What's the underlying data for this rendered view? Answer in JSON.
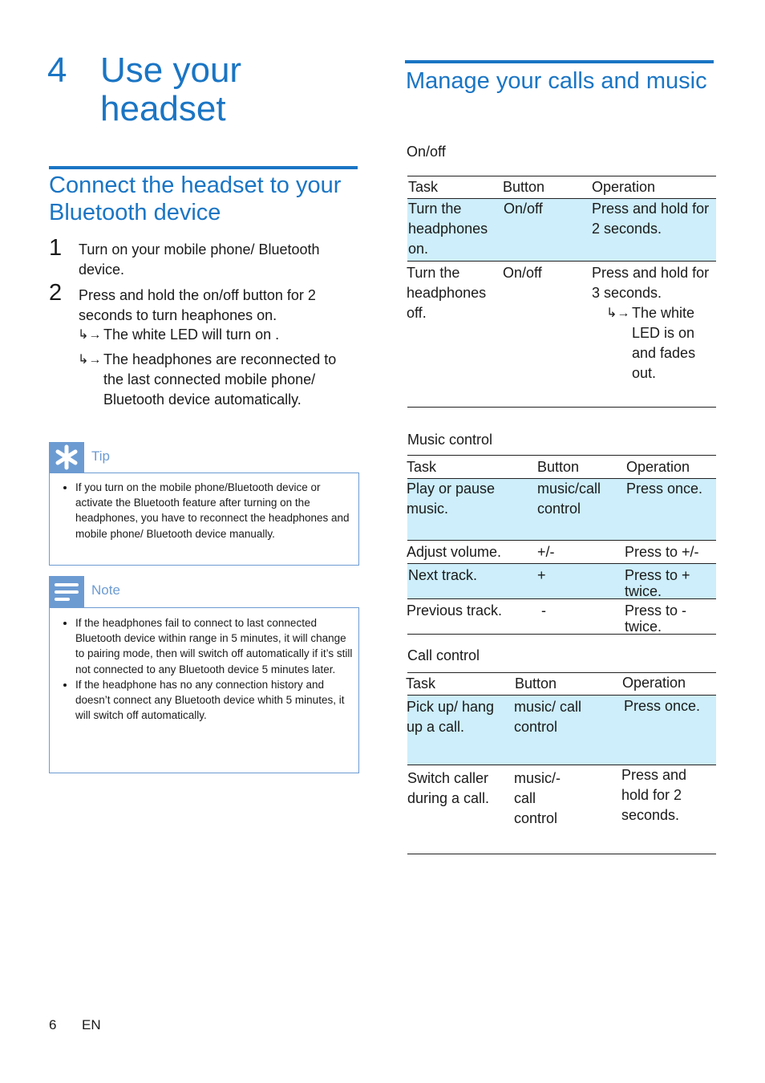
{
  "chapter": {
    "number": "4",
    "title": "Use your headset"
  },
  "connect_section": {
    "title": "Connect the headset to your Bluetooth device",
    "steps": [
      {
        "num": "1",
        "text": "Turn on your mobile phone/ Bluetooth device."
      },
      {
        "num": "2",
        "text": "Press and hold the on/off button for 2 seconds to turn heaphones on."
      }
    ],
    "results": [
      "The white LED will turn on .",
      "The headphones are reconnected to the last connected mobile phone/ Bluetooth device automatically."
    ],
    "result_icon": "↳→"
  },
  "tip": {
    "label": "Tip",
    "icon": "asterisk-icon",
    "items": [
      "If you turn on the mobile phone/Bluetooth device or activate the Bluetooth feature after turning on the headphones, you have to reconnect the headphones and mobile phone/ Bluetooth device manually."
    ]
  },
  "note": {
    "label": "Note",
    "icon": "note-lines-icon",
    "items": [
      "If the headphones fail to connect to last connected Bluetooth device within range in 5 minutes, it will change to pairing mode, then will switch off automatically if it’s still not connected to any Bluetooth device 5 minutes later.",
      "If the headphone has no any connection history and doesn’t connect any Bluetooth device whith 5 minutes, it will switch off automatically."
    ]
  },
  "manage_section": {
    "title": "Manage your calls and music",
    "tables": {
      "onoff": {
        "caption": "On/off",
        "headers": [
          "Task",
          "Button",
          "Operation"
        ],
        "rows": [
          {
            "task": "Turn the headphones on.",
            "button": "On/off",
            "operation": "Press and hold for 2 seconds."
          },
          {
            "task": "Turn the headphones off.",
            "button": "On/off",
            "operation": "Press and hold for 3 seconds.",
            "result": "The white LED is on and fades out."
          }
        ]
      },
      "music": {
        "caption": "Music control",
        "headers": [
          "Task",
          "Button",
          "Operation"
        ],
        "rows": [
          {
            "task": "Play or pause music.",
            "button": "music/call control",
            "operation": "Press once."
          },
          {
            "task": "Adjust volume.",
            "button": "+/-",
            "operation": "Press to +/-"
          },
          {
            "task": "Next track.",
            "button": "+",
            "operation": "Press to + twice."
          },
          {
            "task": "Previous track.",
            "button": "-",
            "operation": "Press to - twice."
          }
        ]
      },
      "call": {
        "caption": "Call control",
        "headers": [
          "Task",
          "Button",
          "Operation"
        ],
        "rows": [
          {
            "task": "Pick up/ hang up a call.",
            "button": "music/ call control",
            "operation": "Press once."
          },
          {
            "task": "Switch caller during a call.",
            "button": "music/- call control",
            "operation": "Press and hold for 2 seconds."
          }
        ]
      }
    }
  },
  "footer": {
    "page": "6",
    "lang": "EN"
  },
  "colors": {
    "accent": "#1a75c4",
    "box": "#6c9bd2",
    "highlight": "#cdeefa"
  }
}
